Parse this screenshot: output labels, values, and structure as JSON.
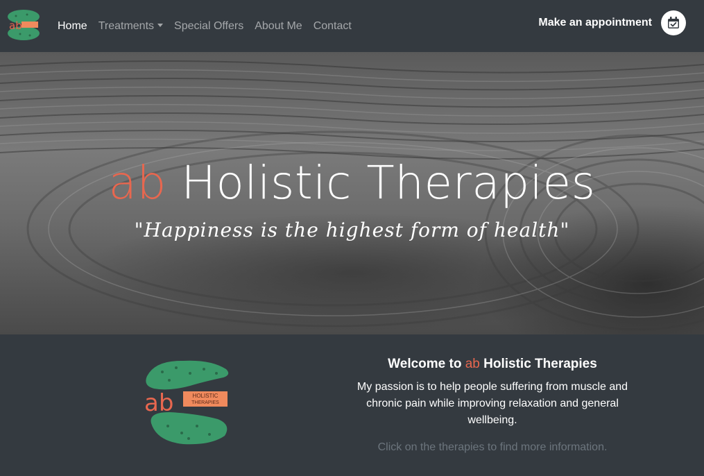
{
  "nav": {
    "logo_icon": "ab-holistic-therapies-logo",
    "items": [
      {
        "label": "Home",
        "active": true
      },
      {
        "label": "Treatments",
        "dropdown": true
      },
      {
        "label": "Special Offers"
      },
      {
        "label": "About Me"
      },
      {
        "label": "Contact"
      }
    ],
    "appointment_label": "Make an appointment",
    "appointment_icon": "calendar-check-icon"
  },
  "hero": {
    "title_prefix": "ab",
    "title_rest": "Holistic Therapies",
    "quote": "\"Happiness is the highest form of health\""
  },
  "welcome": {
    "title_start": "Welcome to",
    "title_ab": "ab",
    "title_rest": "Holistic Therapies",
    "body": "My passion is to help people suffering from muscle and chronic pain while improving relaxation and general wellbeing.",
    "hint": "Click on the therapies to find more information.",
    "logo_text_1": "HOLISTIC",
    "logo_text_2": "THERAPIES",
    "logo_ab": "ab"
  },
  "colors": {
    "accent": "#e8674f",
    "navbar_bg": "#343a40",
    "logo_green": "#3b9a6a",
    "logo_orange": "#f08a5d"
  }
}
